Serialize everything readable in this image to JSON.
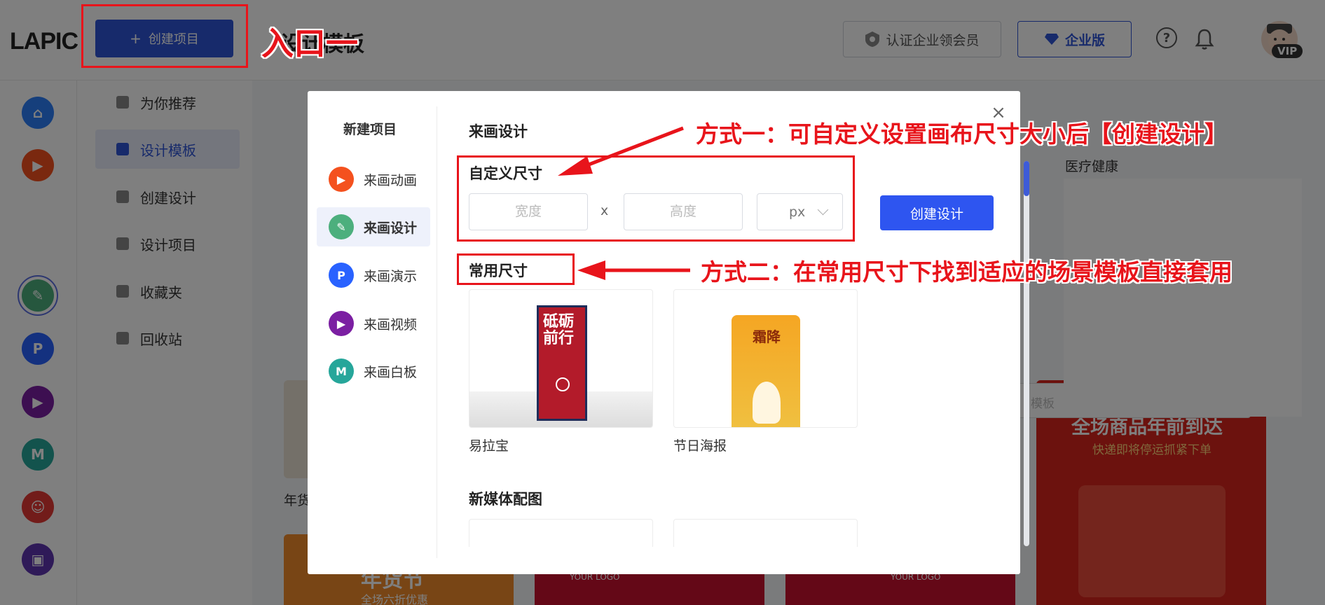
{
  "app": {
    "logo": "LAPIC"
  },
  "header": {
    "create_project": "创建项目",
    "page_title": "设计模板",
    "cert_btn": "认证企业领会员",
    "enterprise_btn": "企业版",
    "vip_badge": "VIP"
  },
  "subnav": {
    "items": [
      {
        "label": "为你推荐"
      },
      {
        "label": "设计模板"
      },
      {
        "label": "创建设计"
      },
      {
        "label": "设计项目"
      },
      {
        "label": "收藏夹"
      },
      {
        "label": "回收站"
      }
    ]
  },
  "background": {
    "tab_medical": "医疗健康",
    "card_year_goods": "年货",
    "promo_headline": "全场商品年前到达",
    "promo_sub": "快递即将停运抓紧下单",
    "banner_text": "年货节",
    "banner_sub": "全场六折优惠",
    "logo_text": "YOUR LOGO",
    "search_hint": "模板"
  },
  "modal": {
    "side_title": "新建项目",
    "side_items": [
      {
        "label": "来画动画",
        "color": "#f4511e"
      },
      {
        "label": "来画设计",
        "color": "#4caf7d"
      },
      {
        "label": "来画演示",
        "color": "#2962ff"
      },
      {
        "label": "来画视频",
        "color": "#7b1fa2"
      },
      {
        "label": "来画白板",
        "color": "#26a69a"
      }
    ],
    "content_title": "来画设计",
    "custom_size_title": "自定义尺寸",
    "width_placeholder": "宽度",
    "height_placeholder": "高度",
    "x_sep": "x",
    "unit": "px",
    "create_button": "创建设计",
    "common_size_title": "常用尺寸",
    "templates": [
      {
        "label": "易拉宝",
        "art_text": "砥砺前行"
      },
      {
        "label": "节日海报",
        "art_text": "霜降"
      }
    ],
    "new_media_title": "新媒体配图",
    "close": "×"
  },
  "annotations": {
    "entry": "入口一",
    "way1": "方式一：可自定义设置画布尺寸大小后【创建设计】",
    "way2": "方式二：在常用尺寸下找到适应的场景模板直接套用",
    "color": "#e8141b"
  }
}
